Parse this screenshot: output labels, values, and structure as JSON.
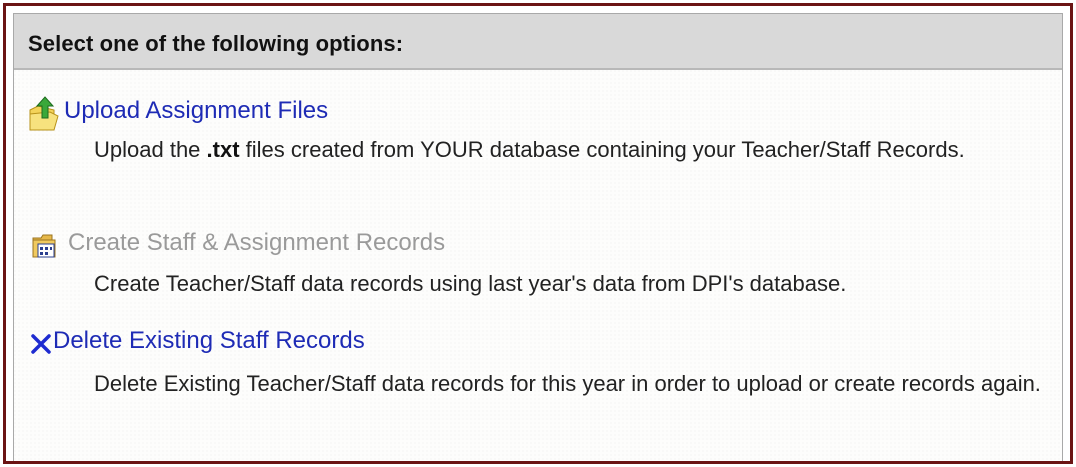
{
  "panel": {
    "title": "Select one of the following options:"
  },
  "options": [
    {
      "label": "Upload Assignment Files",
      "icon": "folder-upload-icon",
      "state": "enabled",
      "description": {
        "before": "Upload the ",
        "bold": ".txt",
        "after": " files created from YOUR database containing your Teacher/Staff Records."
      }
    },
    {
      "label": "Create Staff & Assignment Records",
      "icon": "folder-records-icon",
      "state": "disabled",
      "description": {
        "text": "Create Teacher/Staff data records using last year's data from DPI's database."
      }
    },
    {
      "label": "Delete Existing Staff Records",
      "icon": "delete-x-icon",
      "state": "enabled",
      "description": {
        "text": "Delete Existing Teacher/Staff data records for this year in order to upload or create records again."
      }
    }
  ],
  "colors": {
    "frame_border": "#6b1414",
    "header_bg": "#d9d9d9",
    "link_active": "#1e2bb5",
    "link_disabled": "#9a9a9a"
  }
}
